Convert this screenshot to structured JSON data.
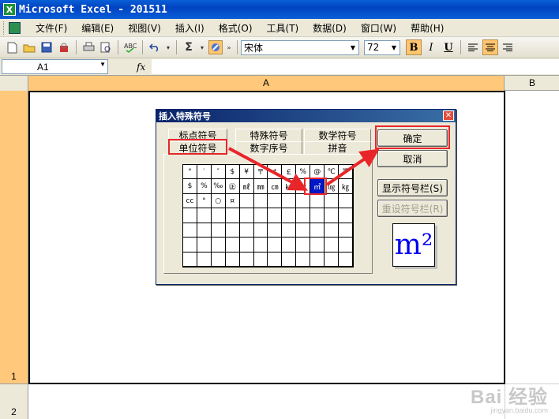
{
  "window": {
    "title": "Microsoft Excel - 201511",
    "app_icon": "X"
  },
  "menu": [
    "文件(F)",
    "编辑(E)",
    "视图(V)",
    "插入(I)",
    "格式(O)",
    "工具(T)",
    "数据(D)",
    "窗口(W)",
    "帮助(H)"
  ],
  "toolbar": {
    "font_name": "宋体",
    "font_size": "72",
    "bold": "B",
    "italic": "I",
    "underline": "U",
    "sigma": "Σ"
  },
  "formula_bar": {
    "name_box": "A1",
    "fx": "fx"
  },
  "sheet": {
    "col_a": "A",
    "col_b": "B",
    "row_1": "1",
    "row_2": "2"
  },
  "dialog": {
    "title": "插入特殊符号",
    "tabs_top": [
      "标点符号",
      "特殊符号",
      "数学符号"
    ],
    "tabs_bottom": [
      "单位符号",
      "数字序号",
      "拼音"
    ],
    "buttons": {
      "ok": "确定",
      "cancel": "取消",
      "show_bar": "显示符号栏(S)",
      "reset_bar": "重设符号栏(R)"
    },
    "preview": "m²",
    "symbols": [
      "°",
      "′",
      "″",
      "$",
      "¥",
      "〒",
      "￠",
      "￡",
      "%",
      "@",
      "℃",
      "℉",
      "$",
      "%",
      "‰",
      "㊣",
      "㎖",
      "㎜",
      "㎝",
      "㎞",
      "㏄",
      "㎡",
      "㏒",
      "㎏",
      "cc",
      "°",
      "○",
      "¤",
      "",
      "",
      "",
      "",
      "",
      "",
      "",
      "",
      "",
      "",
      "",
      "",
      "",
      "",
      "",
      "",
      "",
      "",
      "",
      "",
      "",
      "",
      "",
      "",
      "",
      "",
      "",
      "",
      "",
      "",
      "",
      "",
      "",
      "",
      "",
      "",
      "",
      "",
      "",
      "",
      "",
      "",
      "",
      "",
      "",
      "",
      "",
      "",
      "",
      "",
      "",
      "",
      "",
      "",
      "",
      ""
    ],
    "selected_symbol_index": 21
  },
  "watermark": {
    "brand": "Bai 经验",
    "url": "jingyan.baidu.com"
  },
  "colors": {
    "annotation": "#e8262a",
    "selection": "#0016c9",
    "header_highlight": "#ffc87a"
  }
}
